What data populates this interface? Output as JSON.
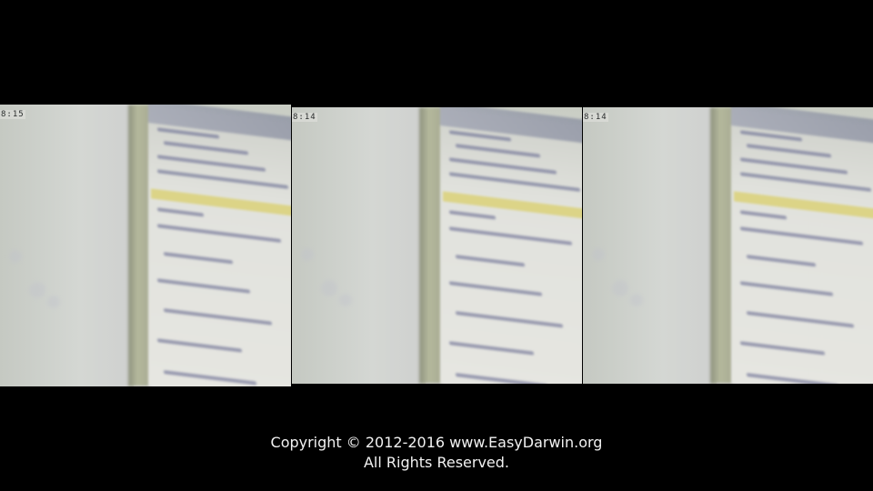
{
  "panels": [
    {
      "timestamp": "8:15"
    },
    {
      "timestamp": "8:14"
    },
    {
      "timestamp": "8:14"
    }
  ],
  "footer": {
    "line1": "Copyright © 2012-2016 www.EasyDarwin.org",
    "line2": "All Rights Reserved."
  },
  "colors": {
    "background": "#000000",
    "footer_text": "#f2f2f2",
    "highlight": "#d9cf6a"
  }
}
